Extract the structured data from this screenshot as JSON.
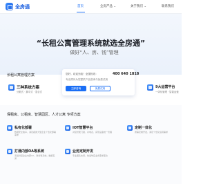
{
  "nav": {
    "logo_text": "全房通",
    "items": [
      {
        "label": "首页",
        "active": true
      },
      {
        "label": "全房产品 ⌄",
        "active": false
      },
      {
        "label": "关于我们 ⌄",
        "active": false
      },
      {
        "label": "联系我们",
        "active": false
      }
    ]
  },
  "hero": {
    "title": "“长租公寓管理系统就选全房通”",
    "subtitle": "做好“人、房、钱”管理"
  },
  "popup": {
    "line1": "您好，欢迎光临！全国热线：",
    "phone": "400 640 1818",
    "line2": "专业顾问为您提供产品咨询与免费试用",
    "primary_btn": "立即咨询",
    "secondary_btn": "免费试用"
  },
  "section1": {
    "title": "长租公寓管理方案",
    "cards": [
      {
        "title": "三种系统方案",
        "desc": "分散式 · 集中式 · 混合式"
      },
      {
        "title": "9大运营平台",
        "desc": "一体化管理 · 智能运营"
      }
    ]
  },
  "section2": {
    "title": "保租房、公租房、智慧园区、人才公寓 专项方案",
    "features": [
      {
        "title": "私有化部署",
        "desc": "数据安全独享，满足各类大型企业个性化部署需求"
      },
      {
        "title": "IOT智慧平台",
        "desc": "对接智能门锁、水电表，实现设备统一管理"
      },
      {
        "title": "定制一体化",
        "desc": "按需定制开发，满足个性化运营需求"
      },
      {
        "title": "打通内部OA等系统",
        "desc": "无缝对接企业内部OA、财务等系统，数据互通"
      },
      {
        "title": "业务定制开发",
        "desc": "专业团队支持，快速响应业务需求变化"
      }
    ]
  }
}
